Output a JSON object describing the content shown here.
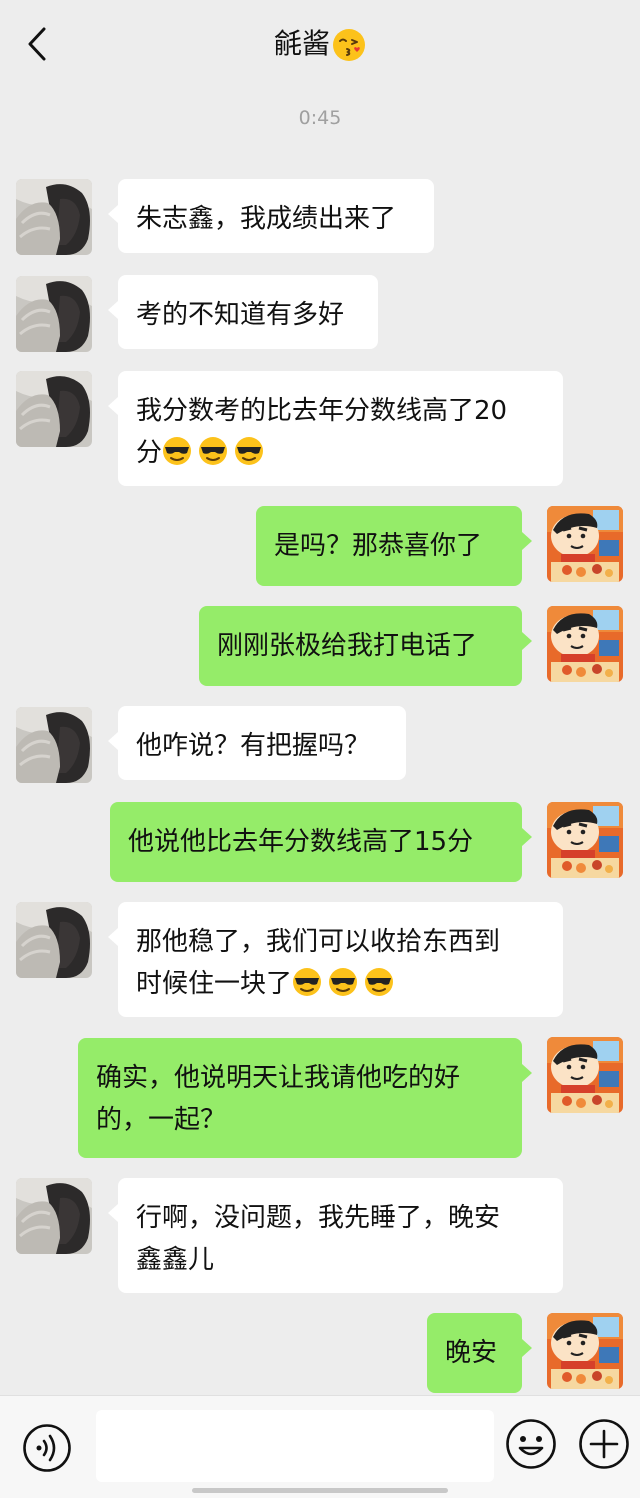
{
  "header": {
    "title": "毹酱",
    "title_emoji": "kissing-face-emoji"
  },
  "timestamp": "0:45",
  "colors": {
    "background": "#ededed",
    "incoming_bubble": "#ffffff",
    "outgoing_bubble": "#95ec69"
  },
  "messages": [
    {
      "side": "left",
      "lines": [
        "朱志鑫，我成绩出来了"
      ]
    },
    {
      "side": "left",
      "lines": [
        "考的不知道有多好"
      ]
    },
    {
      "side": "left",
      "lines": [
        "我分数考的比去年分数线高了20",
        "分"
      ],
      "emojis": [
        "sunglasses",
        "sunglasses",
        "sunglasses"
      ]
    },
    {
      "side": "right",
      "lines": [
        "是吗？那恭喜你了"
      ]
    },
    {
      "side": "right",
      "lines": [
        "刚刚张极给我打电话了"
      ]
    },
    {
      "side": "left",
      "lines": [
        "他咋说？有把握吗？"
      ]
    },
    {
      "side": "right",
      "lines": [
        "他说他比去年分数线高了15分"
      ]
    },
    {
      "side": "left",
      "lines": [
        "那他稳了，我们可以收拾东西到",
        "时候住一块了"
      ],
      "emojis": [
        "sunglasses",
        "sunglasses",
        "sunglasses"
      ]
    },
    {
      "side": "right",
      "lines": [
        "确实，他说明天让我请他吃的好",
        "的，一起？"
      ]
    },
    {
      "side": "left",
      "lines": [
        "行啊，没问题，我先睡了，晚安",
        "鑫鑫儿"
      ]
    },
    {
      "side": "right",
      "lines": [
        "晚安"
      ]
    }
  ],
  "input_bar": {
    "placeholder": "",
    "icons": [
      "voice-icon",
      "emoji-icon",
      "plus-icon"
    ]
  }
}
